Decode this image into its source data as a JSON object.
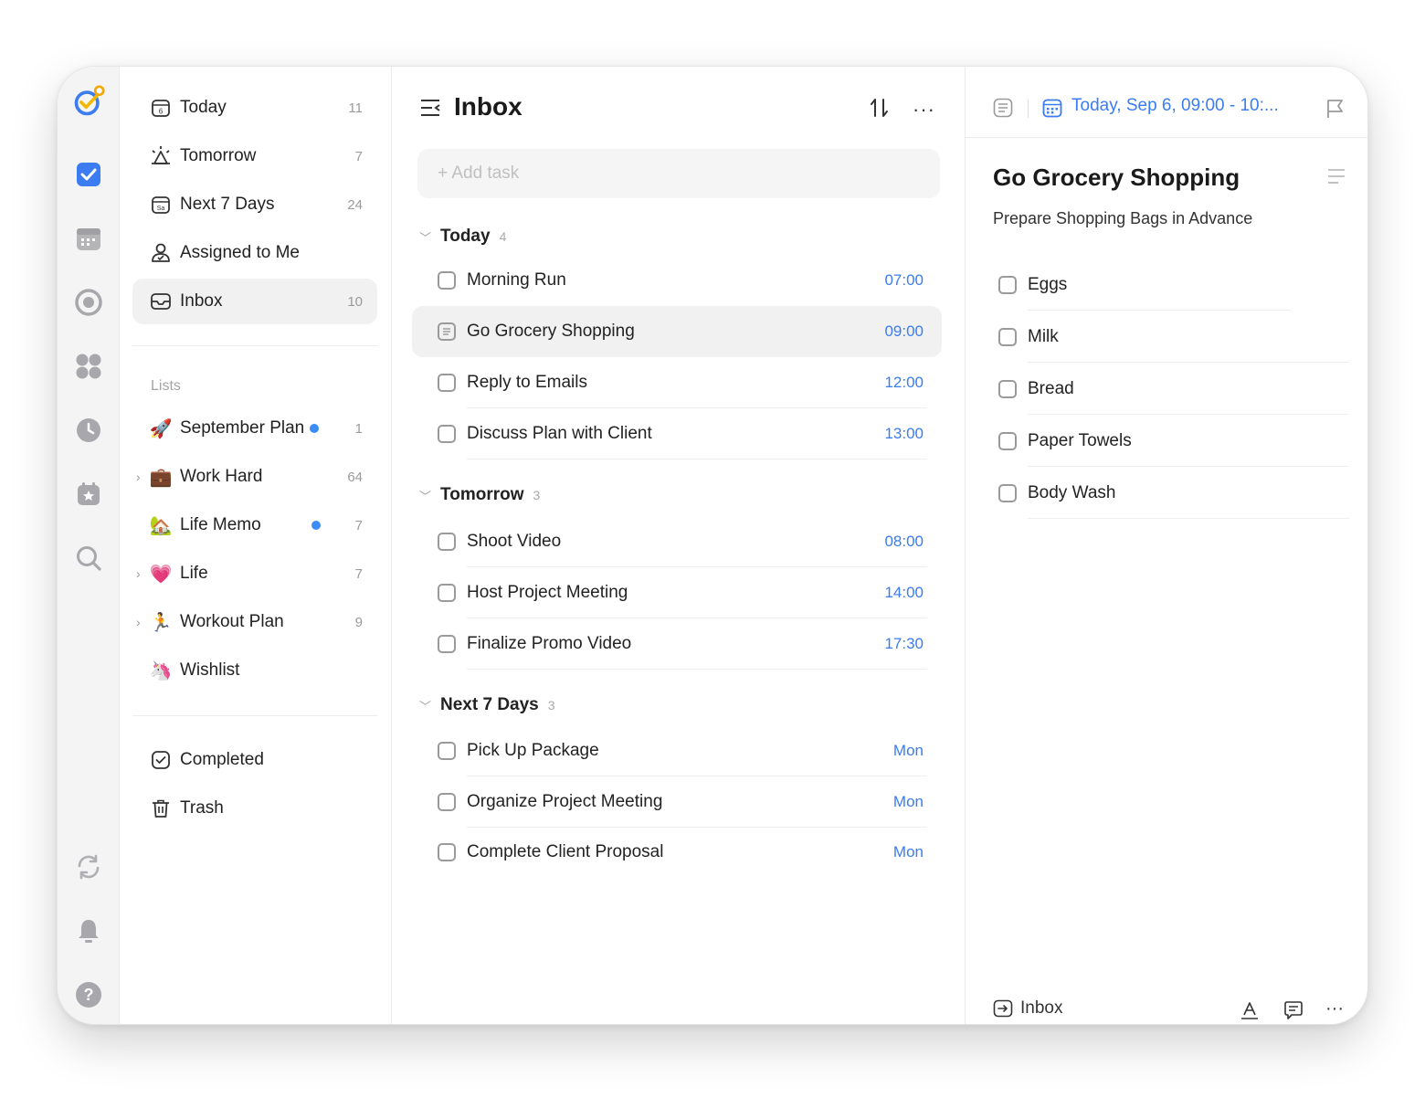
{
  "sidebar": {
    "smart_lists": [
      {
        "label": "Today",
        "count": "11",
        "icon": "calendar-6-icon"
      },
      {
        "label": "Tomorrow",
        "count": "7",
        "icon": "sunrise-icon"
      },
      {
        "label": "Next 7 Days",
        "count": "24",
        "icon": "calendar-sa-icon"
      },
      {
        "label": "Assigned to Me",
        "count": "",
        "icon": "person-icon"
      },
      {
        "label": "Inbox",
        "count": "10",
        "icon": "inbox-icon"
      }
    ],
    "lists_header": "Lists",
    "lists": [
      {
        "label": "September Plan",
        "count": "1",
        "emoji": "🚀"
      },
      {
        "label": "Work Hard",
        "count": "64",
        "emoji": "💼"
      },
      {
        "label": "Life Memo",
        "count": "7",
        "emoji": "🏡"
      },
      {
        "label": "Life",
        "count": "7",
        "emoji": "💗"
      },
      {
        "label": "Workout Plan",
        "count": "9",
        "emoji": "🏃"
      },
      {
        "label": "Wishlist",
        "count": "",
        "emoji": "🦄"
      }
    ],
    "bottom": [
      {
        "label": "Completed",
        "icon": "check-square-icon"
      },
      {
        "label": "Trash",
        "icon": "trash-icon"
      }
    ]
  },
  "middle": {
    "title": "Inbox",
    "add_placeholder": "+ Add task",
    "groups": [
      {
        "title": "Today",
        "count": "4",
        "tasks": [
          {
            "title": "Morning Run",
            "time": "07:00"
          },
          {
            "title": "Go Grocery Shopping",
            "time": "09:00"
          },
          {
            "title": "Reply to Emails",
            "time": "12:00"
          },
          {
            "title": "Discuss Plan with Client",
            "time": "13:00"
          }
        ]
      },
      {
        "title": "Tomorrow",
        "count": "3",
        "tasks": [
          {
            "title": "Shoot Video",
            "time": "08:00"
          },
          {
            "title": "Host Project Meeting",
            "time": "14:00"
          },
          {
            "title": "Finalize Promo Video",
            "time": "17:30"
          }
        ]
      },
      {
        "title": "Next 7 Days",
        "count": "3",
        "tasks": [
          {
            "title": "Pick Up Package",
            "time": "Mon"
          },
          {
            "title": "Organize Project Meeting",
            "time": "Mon"
          },
          {
            "title": "Complete Client Proposal",
            "time": "Mon"
          }
        ]
      }
    ]
  },
  "detail": {
    "date": "Today, Sep 6, 09:00 - 10:...",
    "title": "Go Grocery Shopping",
    "subtitle": "Prepare Shopping Bags in Advance",
    "subtasks": [
      "Eggs",
      "Milk",
      "Bread",
      "Paper Towels",
      "Body Wash"
    ],
    "list_name": "Inbox"
  },
  "colors": {
    "accent": "#3b7cf0",
    "dot": "#3b8cf6"
  }
}
